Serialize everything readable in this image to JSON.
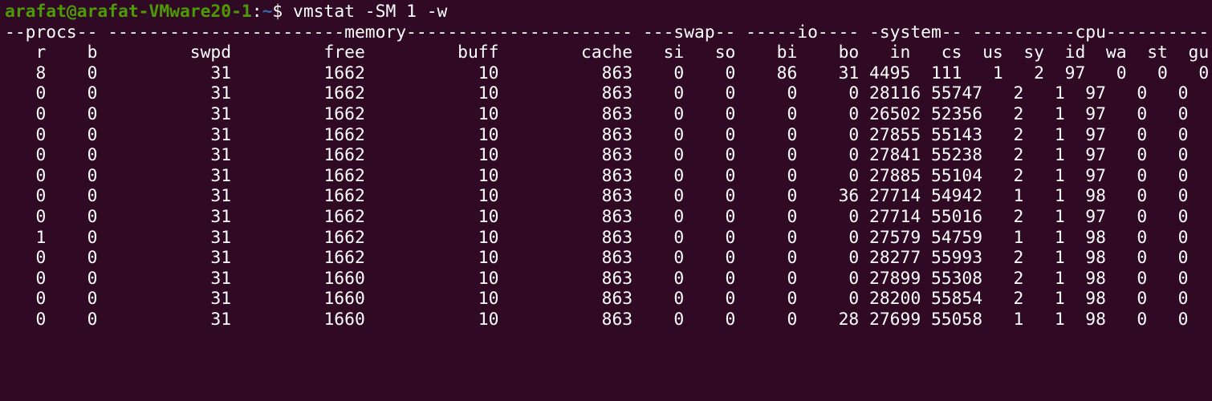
{
  "colors": {
    "background": "#300a24",
    "text": "#ffffff",
    "prompt_user_host": "#4e9a06",
    "prompt_path": "#3465a4"
  },
  "prompt": {
    "user_host": "arafat@arafat-VMware20-1",
    "separator": ":",
    "path": "~",
    "symbol": "$ ",
    "command": "vmstat -SM 1 -w"
  },
  "output": {
    "group_header": "--procs-- -----------------------memory---------------------- ---swap-- -----io---- -system-- ----------cpu----------",
    "column_header": "   r    b         swpd         free         buff        cache   si   so    bi    bo   in   cs  us  sy  id  wa  st  gu",
    "rows": [
      "   8    0           31         1662           10          863    0    0    86    31 4495  111   1   2  97   0   0   0",
      "   0    0           31         1662           10          863    0    0     0     0 28116 55747   2   1  97   0   0   0",
      "   0    0           31         1662           10          863    0    0     0     0 26502 52356   2   1  97   0   0   0",
      "   0    0           31         1662           10          863    0    0     0     0 27855 55143   2   1  97   0   0   0",
      "   0    0           31         1662           10          863    0    0     0     0 27841 55238   2   1  97   0   0   0",
      "   0    0           31         1662           10          863    0    0     0     0 27885 55104   2   1  97   0   0   0",
      "   0    0           31         1662           10          863    0    0     0    36 27714 54942   1   1  98   0   0   0",
      "   0    0           31         1662           10          863    0    0     0     0 27714 55016   2   1  97   0   0   0",
      "   1    0           31         1662           10          863    0    0     0     0 27579 54759   1   1  98   0   0   0",
      "   0    0           31         1662           10          863    0    0     0     0 28277 55993   2   1  98   0   0   0",
      "   0    0           31         1660           10          863    0    0     0     0 27899 55308   2   1  98   0   0   0",
      "   0    0           31         1660           10          863    0    0     0     0 28200 55854   2   1  98   0   0   0",
      "   0    0           31         1660           10          863    0    0     0    28 27699 55058   1   1  98   0   0   0"
    ]
  }
}
